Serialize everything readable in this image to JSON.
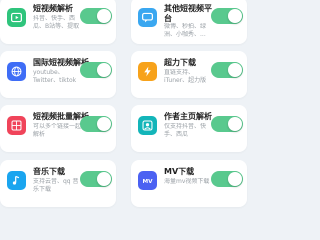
{
  "cards": [
    {
      "title": "短视频解析",
      "desc": "抖音、快手、西瓜、B站等、提取",
      "icon": "video-play-icon",
      "color": "#2fc47c",
      "enabled": true
    },
    {
      "title": "其他短视频平台",
      "desc": "微博、秒拍、绿洲、小咖秀、...",
      "icon": "chat-bubble-icon",
      "color": "#3aa7f0",
      "enabled": true
    },
    {
      "title": "国际短视频解析",
      "desc": "youtube、Twitter、tiktok",
      "icon": "globe-icon",
      "color": "#3f6df6",
      "enabled": true
    },
    {
      "title": "超力下载",
      "desc": "直链支持、iTuner、超力版",
      "icon": "lightning-icon",
      "color": "#f7a21b",
      "enabled": true
    },
    {
      "title": "短视频批量解析",
      "desc": "可以多个链接一起解析",
      "icon": "batch-grid-icon",
      "color": "#f0445a",
      "enabled": true
    },
    {
      "title": "作者主页解析",
      "desc": "仅支持抖音、快手、西瓜",
      "icon": "user-profile-icon",
      "color": "#13b5b9",
      "enabled": true
    },
    {
      "title": "音乐下载",
      "desc": "支持云音、qq 音乐下载",
      "icon": "music-note-icon",
      "color": "#1aa5ef",
      "enabled": true
    },
    {
      "title": "MV下载",
      "desc": "海量mv视频下载",
      "icon": "mv-badge-icon",
      "color": "#4b61f2",
      "enabled": true
    }
  ],
  "colors": {
    "toggle_on": "#59c98e",
    "card_bg": "#ffffff",
    "page_bg": "#eef2f6"
  }
}
